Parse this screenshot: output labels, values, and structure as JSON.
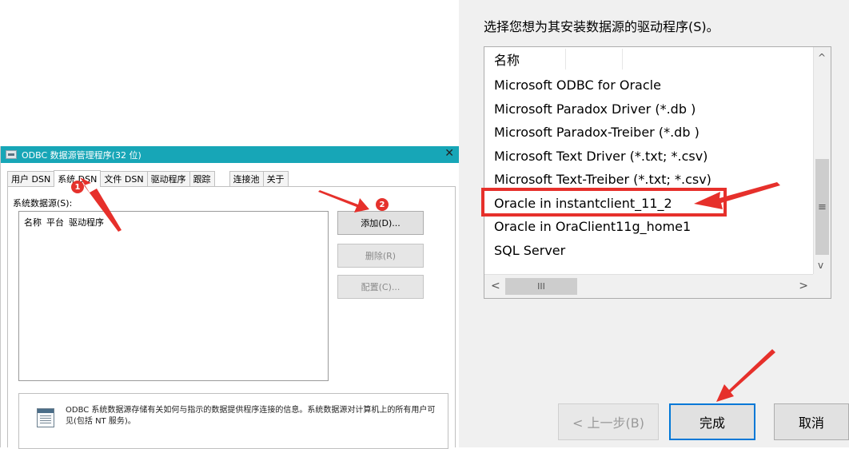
{
  "odbc": {
    "title": "ODBC 数据源管理程序(32 位)",
    "close": "✕",
    "tabs": [
      "用户 DSN",
      "系统 DSN",
      "文件 DSN",
      "驱动程序",
      "跟踪",
      "连接池",
      "关于"
    ],
    "system_ds_label": "系统数据源(S):",
    "columns": [
      "名称",
      "平台",
      "驱动程序"
    ],
    "buttons": {
      "add": "添加(D)...",
      "remove": "删除(R)",
      "configure": "配置(C)..."
    },
    "info": "ODBC 系统数据源存储有关如何与指示的数据提供程序连接的信息。系统数据源对计算机上的所有用户可见(包括 NT 服务)。",
    "badges": [
      "1",
      "2"
    ]
  },
  "driver_dialog": {
    "heading": "选择您想为其安装数据源的驱动程序(S)。",
    "column_header": "名称",
    "drivers": [
      "Microsoft ODBC for Oracle",
      "Microsoft Paradox Driver (*.db )",
      "Microsoft Paradox-Treiber (*.db )",
      "Microsoft Text Driver (*.txt; *.csv)",
      "Microsoft Text-Treiber (*.txt; *.csv)",
      "Oracle in instantclient_11_2",
      "Oracle in OraClient11g_home1",
      "SQL Server"
    ],
    "highlighted_driver": "Oracle in instantclient_11_2",
    "scroll": {
      "up": "^",
      "down": "v",
      "left": "<",
      "right": ">",
      "thumb": "≡",
      "hthumb": "III"
    },
    "buttons": {
      "back": "< 上一步(B)",
      "finish": "完成",
      "cancel": "取消"
    }
  },
  "colors": {
    "titlebar": "#17a6b7",
    "annotation": "#e6302b",
    "focus": "#0078d7"
  }
}
